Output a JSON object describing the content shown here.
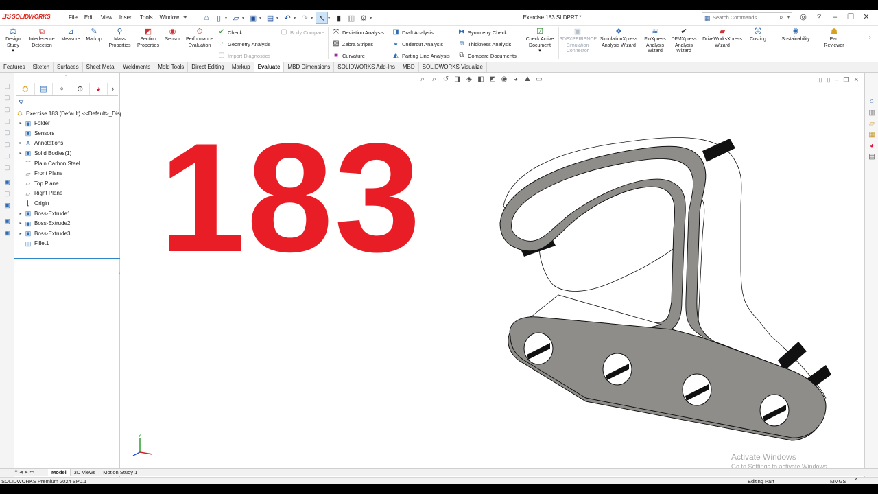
{
  "app": {
    "brand": "SOLIDWORKS",
    "document_title": "Exercise 183.SLDPRT *"
  },
  "menus": [
    "File",
    "Edit",
    "View",
    "Insert",
    "Tools",
    "Window"
  ],
  "search": {
    "placeholder": "Search Commands"
  },
  "ribbon": {
    "design_study": "Design Study",
    "interference_detection": "Interference Detection",
    "measure": "Measure",
    "markup": "Markup",
    "mass_properties": "Mass Properties",
    "section_properties": "Section Properties",
    "sensor": "Sensor",
    "performance_evaluation": "Performance Evaluation",
    "check": "Check",
    "geometry_analysis": "Geometry Analysis",
    "import_diagnostics": "Import Diagnostics",
    "body_compare": "Body Compare",
    "deviation_analysis": "Deviation Analysis",
    "zebra_stripes": "Zebra Stripes",
    "curvature": "Curvature",
    "draft_analysis": "Draft Analysis",
    "undercut_analysis": "Undercut Analysis",
    "parting_line_analysis": "Parting Line Analysis",
    "symmetry_check": "Symmetry Check",
    "thickness_analysis": "Thickness Analysis",
    "compare_documents": "Compare Documents",
    "check_active_document": "Check Active Document",
    "simulation_connector": "3DEXPERIENCE Simulation Connector",
    "simulationxpress": "SimulationXpress Analysis Wizard",
    "floxpress": "FloXpress Analysis Wizard",
    "dfmxpress": "DFMXpress Analysis Wizard",
    "driveworksxpress": "DriveWorksXpress Wizard",
    "costing": "Costing",
    "sustainability": "Sustainability",
    "part_reviewer": "Part Reviewer"
  },
  "tabs": [
    "Features",
    "Sketch",
    "Surfaces",
    "Sheet Metal",
    "Weldments",
    "Mold Tools",
    "Direct Editing",
    "Markup",
    "Evaluate",
    "MBD Dimensions",
    "SOLIDWORKS Add-Ins",
    "MBD",
    "SOLIDWORKS Visualize"
  ],
  "active_tab": "Evaluate",
  "tree": {
    "root": "Exercise 183 (Default) <<Default>_Disp",
    "items": [
      {
        "label": "Folder",
        "expandable": true
      },
      {
        "label": "Sensors",
        "expandable": false
      },
      {
        "label": "Annotations",
        "expandable": true
      },
      {
        "label": "Solid Bodies(1)",
        "expandable": true
      },
      {
        "label": "Plain Carbon Steel",
        "expandable": false
      },
      {
        "label": "Front Plane",
        "expandable": false
      },
      {
        "label": "Top Plane",
        "expandable": false
      },
      {
        "label": "Right Plane",
        "expandable": false
      },
      {
        "label": "Origin",
        "expandable": false
      },
      {
        "label": "Boss-Extrude1",
        "expandable": true
      },
      {
        "label": "Boss-Extrude2",
        "expandable": true
      },
      {
        "label": "Boss-Extrude3",
        "expandable": true
      },
      {
        "label": "Fillet1",
        "expandable": false
      }
    ]
  },
  "viewport": {
    "exercise_number": "183",
    "triad_label": "Y",
    "accent_color": "#e81d25"
  },
  "watermark": {
    "line1": "Activate Windows",
    "line2": "Go to Settings to activate Windows."
  },
  "bottom_tabs": [
    "Model",
    "3D Views",
    "Motion Study 1"
  ],
  "active_bottom_tab": "Model",
  "status": {
    "product": "SOLIDWORKS Premium 2024 SP0.1",
    "mode": "Editing Part",
    "units": "MMGS"
  }
}
